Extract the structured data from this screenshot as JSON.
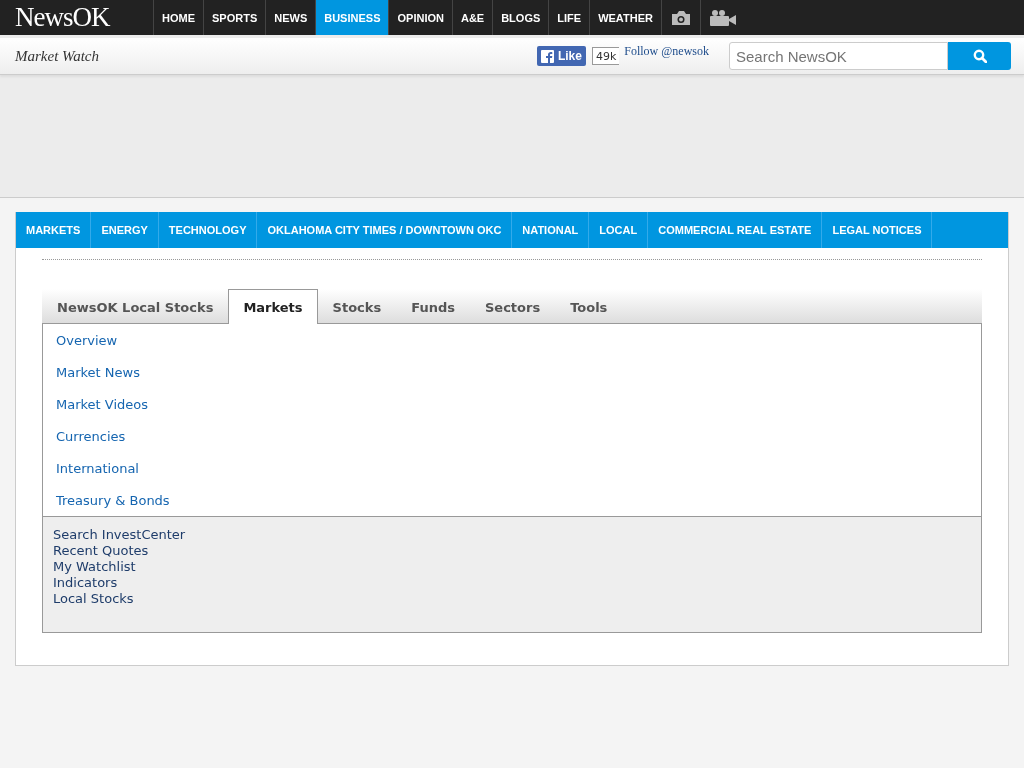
{
  "top_nav": {
    "logo": "NewsOK",
    "items": [
      {
        "label": "HOME",
        "selected": false
      },
      {
        "label": "SPORTS",
        "selected": false
      },
      {
        "label": "NEWS",
        "selected": false
      },
      {
        "label": "BUSINESS",
        "selected": true
      },
      {
        "label": "OPINION",
        "selected": false
      },
      {
        "label": "A&E",
        "selected": false
      },
      {
        "label": "BLOGS",
        "selected": false
      },
      {
        "label": "LIFE",
        "selected": false
      },
      {
        "label": "WEATHER",
        "selected": false
      }
    ]
  },
  "sub_bar": {
    "title": "Market Watch",
    "like_button": "Like",
    "like_count": "49k",
    "follow_link": "Follow @newsok",
    "search": {
      "placeholder": "Search NewsOK"
    }
  },
  "section_nav": [
    {
      "label": "MARKETS"
    },
    {
      "label": "ENERGY"
    },
    {
      "label": "TECHNOLOGY"
    },
    {
      "label": "OKLAHOMA CITY TIMES / DOWNTOWN OKC"
    },
    {
      "label": "NATIONAL"
    },
    {
      "label": "LOCAL"
    },
    {
      "label": "COMMERCIAL REAL ESTATE"
    },
    {
      "label": "LEGAL NOTICES"
    }
  ],
  "tabs": [
    {
      "label": "NewsOK Local Stocks",
      "selected": false
    },
    {
      "label": "Markets",
      "selected": true
    },
    {
      "label": "Stocks",
      "selected": false
    },
    {
      "label": "Funds",
      "selected": false
    },
    {
      "label": "Sectors",
      "selected": false
    },
    {
      "label": "Tools",
      "selected": false
    }
  ],
  "market_links": [
    "Overview",
    "Market News",
    "Market Videos",
    "Currencies",
    "International",
    "Treasury & Bonds"
  ],
  "tool_links": [
    "Search InvestCenter",
    "Recent Quotes",
    "My Watchlist",
    "Indicators",
    "Local Stocks"
  ]
}
